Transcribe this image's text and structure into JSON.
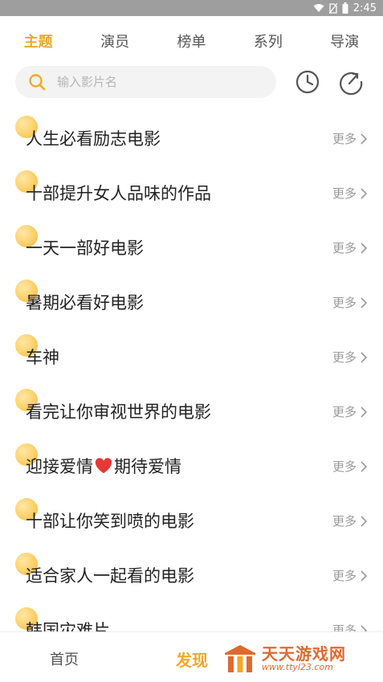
{
  "status_bar": {
    "time": "2:45"
  },
  "tabs": [
    {
      "label": "主题",
      "active": true
    },
    {
      "label": "演员",
      "active": false
    },
    {
      "label": "榜单",
      "active": false
    },
    {
      "label": "系列",
      "active": false
    },
    {
      "label": "导演",
      "active": false
    }
  ],
  "search": {
    "placeholder": "输入影片名",
    "value": ""
  },
  "icons": {
    "search": "search-icon",
    "history": "clock-icon",
    "share": "share-icon",
    "more": "chevron-right-icon",
    "heart": "heart-icon"
  },
  "list": {
    "more_label": "更多",
    "items": [
      {
        "title": "人生必看励志电影"
      },
      {
        "title": "十部提升女人品味的作品"
      },
      {
        "title": "一天一部好电影"
      },
      {
        "title": "暑期必看好电影"
      },
      {
        "title": "车神"
      },
      {
        "title": "看完让你审视世界的电影"
      },
      {
        "title_part1": "迎接爱情",
        "title_part2": "期待爱情"
      },
      {
        "title": "十部让你笑到喷的电影"
      },
      {
        "title": "适合家人一起看的电影"
      },
      {
        "title": "韩国灾难片"
      }
    ]
  },
  "bottom_nav": {
    "home": "首页",
    "discover": "发现"
  },
  "watermark": {
    "brand": "天天游戏网",
    "url": "www.ttyl23.com"
  },
  "colors": {
    "accent": "#f0a92a",
    "status_bar": "#9e9e9e",
    "heart": "#e53935"
  }
}
